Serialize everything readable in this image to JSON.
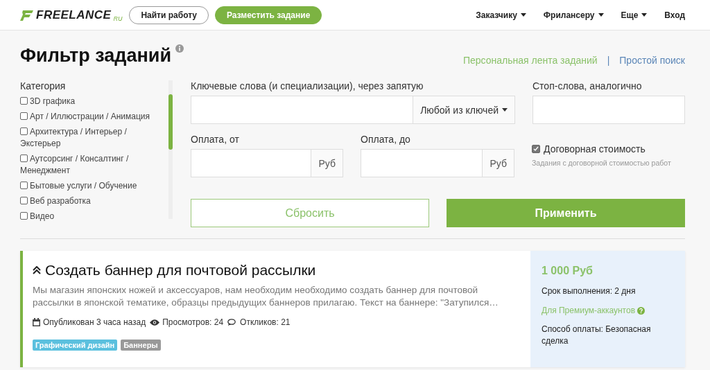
{
  "header": {
    "logo": {
      "text": "FREELANCE",
      "suffix": "RU"
    },
    "buttons": [
      {
        "label": "Найти работу",
        "kind": "outline"
      },
      {
        "label": "Разместить задание",
        "kind": "primary"
      }
    ],
    "nav": [
      {
        "label": "Заказчику",
        "dropdown": true
      },
      {
        "label": "Фрилансеру",
        "dropdown": true
      },
      {
        "label": "Еще",
        "dropdown": true
      },
      {
        "label": "Вход",
        "dropdown": false
      }
    ]
  },
  "filter": {
    "title": "Фильтр заданий",
    "links": [
      {
        "label": "Персональная лента заданий",
        "kind": "green"
      },
      {
        "label": "Простой поиск",
        "kind": "blue"
      }
    ],
    "links_separator": "|",
    "category_label": "Категория",
    "categories": [
      {
        "label": "3D графика",
        "checked": false
      },
      {
        "label": "Арт / Иллюстрации / Анимация",
        "checked": false
      },
      {
        "label": "Архитектура / Интерьер / Экстерьер",
        "checked": false
      },
      {
        "label": "Аутсорсинг / Консалтинг / Менеджмент",
        "checked": false
      },
      {
        "label": "Бытовые услуги / Обучение",
        "checked": false
      },
      {
        "label": "Веб разработка",
        "checked": false
      },
      {
        "label": "Видео",
        "checked": false
      }
    ],
    "keywords_label": "Ключевые слова (и специализации), через запятую",
    "keywords_mode": "Любой из ключей",
    "stopwords_label": "Стоп-слова, аналогично",
    "pay_from_label": "Оплата, от",
    "pay_from_unit": "Руб",
    "pay_to_label": "Оплата, до",
    "pay_to_unit": "Руб",
    "negotiable": {
      "label": "Договорная стоимость",
      "checked": true,
      "hint": "Задания с договорной стоимостью работ"
    },
    "reset_button": "Сбросить",
    "apply_button": "Применить"
  },
  "tasks": [
    {
      "title": "Создать баннер для почтовой рассылки",
      "description": "Мы магазин японских ножей и аксессуаров, нам необходим необходимо создать баннер для почтовой рассылки в японской тематике, образцы предыдущих баннеров прилагаю. Текст на баннере: \"Затупился…",
      "published": "Опубликован 3 часа назад",
      "views": "Просмотров: 24",
      "responses": "Откликов: 21",
      "tags": [
        {
          "label": "Графический дизайн",
          "color": "#5bc0de"
        },
        {
          "label": "Баннеры",
          "color": "#999999"
        }
      ],
      "price": "1 000 Руб",
      "deadline": "Срок выполнения: 2 дня",
      "premium": "Для Премиум-аккаунтов",
      "payment": "Способ оплаты: Безопасная сделка"
    }
  ]
}
